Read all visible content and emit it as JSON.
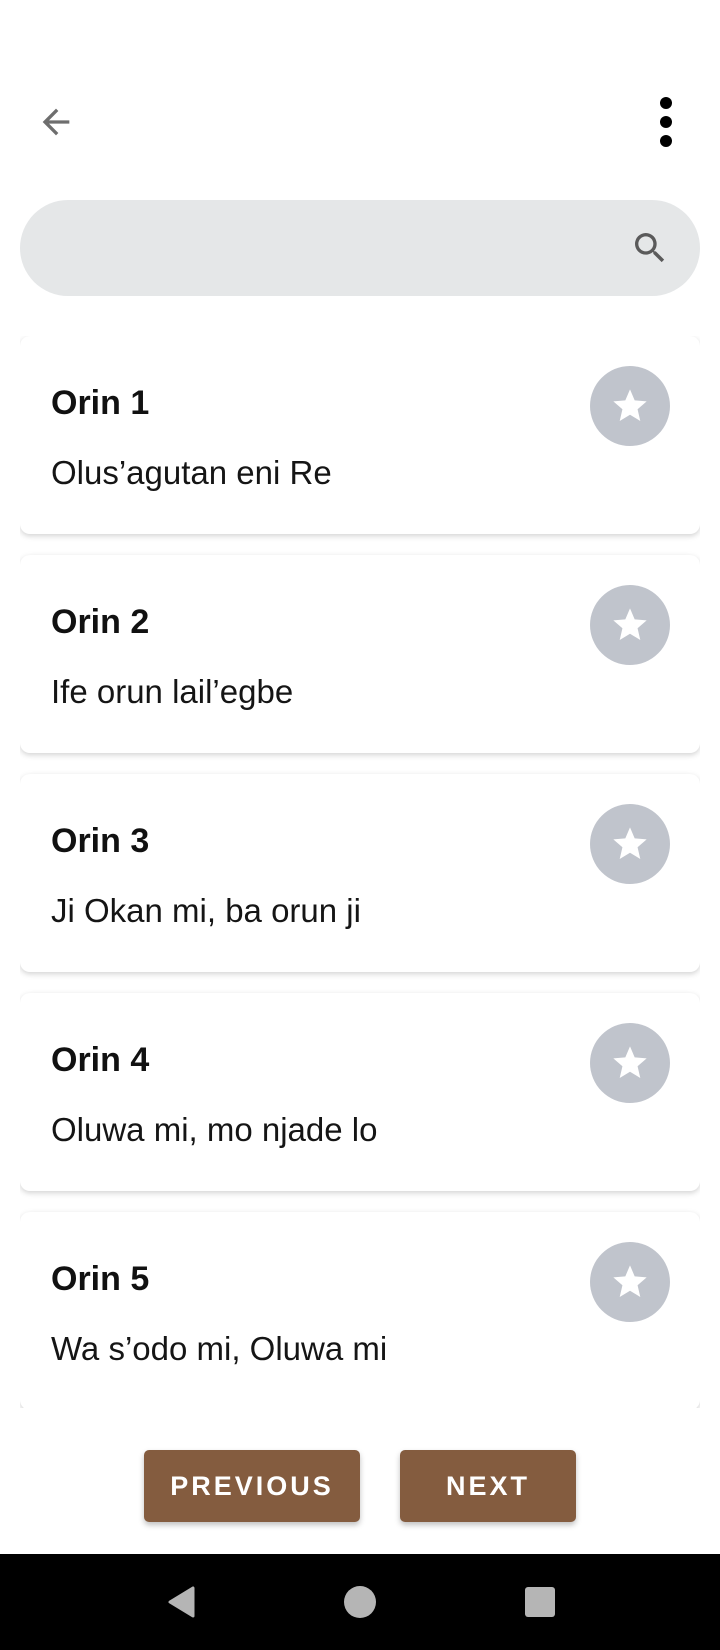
{
  "search": {
    "value": "",
    "placeholder": ""
  },
  "items": [
    {
      "title": "Orin 1",
      "subtitle": "Olus’agutan eni Re"
    },
    {
      "title": "Orin 2",
      "subtitle": "Ife orun lail’egbe"
    },
    {
      "title": "Orin 3",
      "subtitle": "Ji Okan mi, ba orun ji"
    },
    {
      "title": "Orin 4",
      "subtitle": "Oluwa mi, mo njade lo"
    },
    {
      "title": "Orin 5",
      "subtitle": "Wa s’odo mi, Oluwa mi"
    }
  ],
  "buttons": {
    "previous": "PREVIOUS",
    "next": "NEXT"
  },
  "icons": {
    "back": "arrow-left-icon",
    "more": "more-vert-icon",
    "search": "search-icon",
    "favorite": "star-icon",
    "system_back": "system-back-icon",
    "system_home": "system-home-icon",
    "system_recents": "system-recents-icon"
  },
  "colors": {
    "background": "#ffffff",
    "search_bg": "#e5e7e8",
    "favorite_circle": "#c0c4cc",
    "button_bg": "#845c3f",
    "button_text": "#ffffff",
    "system_bar": "#000000"
  }
}
